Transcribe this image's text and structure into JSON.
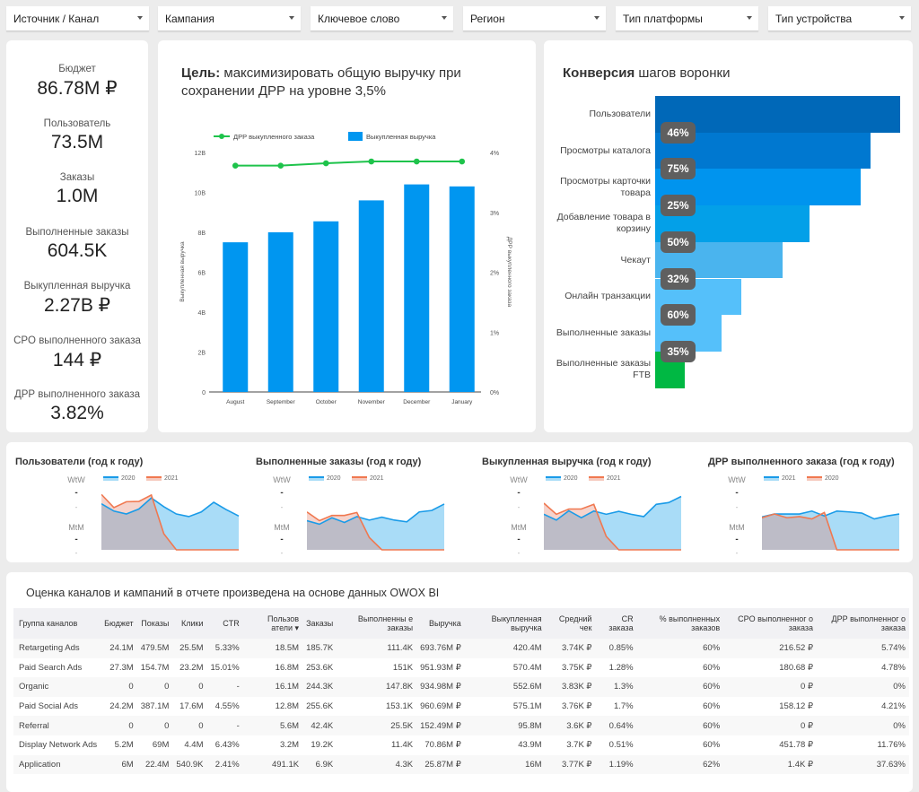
{
  "filters": [
    "Источник / Канал",
    "Кампания",
    "Ключевое слово",
    "Регион",
    "Тип платформы",
    "Тип устройства"
  ],
  "kpis": [
    {
      "label": "Бюджет",
      "value": "86.78M ₽"
    },
    {
      "label": "Пользователь",
      "value": "73.5M"
    },
    {
      "label": "Заказы",
      "value": "1.0M"
    },
    {
      "label": "Выполненные заказы",
      "value": "604.5K"
    },
    {
      "label": "Выкупленная выручка",
      "value": "2.27B ₽"
    },
    {
      "label": "CPO выполненного заказа",
      "value": "144 ₽"
    },
    {
      "label": "ДРР выполненного заказа",
      "value": "3.82%"
    }
  ],
  "goal_title": {
    "bold": "Цель:",
    "rest": " максимизировать общую выручку при сохранении ДРР на уровне 3,5%"
  },
  "chart_data": [
    {
      "type": "bar+line",
      "categories": [
        "August",
        "September",
        "October",
        "November",
        "December",
        "January"
      ],
      "series": [
        {
          "name": "Выкупленная выручка",
          "kind": "bar",
          "axis": "left",
          "color": "#0096f0",
          "values": [
            7.5,
            8.0,
            8.55,
            9.6,
            10.4,
            10.3
          ]
        },
        {
          "name": "ДРР выкупленного заказа",
          "kind": "line",
          "axis": "right",
          "color": "#1ec34b",
          "values": [
            3.78,
            3.78,
            3.82,
            3.85,
            3.85,
            3.85
          ]
        }
      ],
      "ylabel": "Выкупленная выручка",
      "y2label": "ДРР выкупленного заказа",
      "ylim": [
        0,
        12
      ],
      "y_ticks": [
        "0",
        "2B",
        "4B",
        "6B",
        "8B",
        "10B",
        "12B"
      ],
      "y2lim": [
        0,
        4
      ],
      "y2_ticks": [
        "0%",
        "1%",
        "2%",
        "3%",
        "4%"
      ],
      "legend": "top",
      "grid": false
    },
    {
      "type": "funnel",
      "title_bold": "Конверсия",
      "title_rest": " шагов воронки",
      "steps": [
        {
          "label": "Пользователи",
          "relative": 1.0,
          "color": "#0068b8"
        },
        {
          "label": "Просмотры каталога",
          "relative": 0.88,
          "color": "#0078d0"
        },
        {
          "label": "Просмотры карточки товара",
          "relative": 0.84,
          "color": "#0094ee"
        },
        {
          "label": "Добавление товара в корзину",
          "relative": 0.63,
          "color": "#03a0e8"
        },
        {
          "label": "Чекаут",
          "relative": 0.52,
          "color": "#4ab4ee"
        },
        {
          "label": "Онлайн транзакции",
          "relative": 0.35,
          "color": "#55c0fa"
        },
        {
          "label": "Выполненные заказы",
          "relative": 0.27,
          "color": "#55c0fa"
        },
        {
          "label": "Выполненные заказы FTB",
          "relative": 0.12,
          "color": "#00b843"
        }
      ],
      "conversions": [
        "46%",
        "75%",
        "25%",
        "50%",
        "32%",
        "60%",
        "35%"
      ]
    },
    {
      "type": "area",
      "title": "Пользователи (год к году)",
      "labels": [
        "WtW",
        "MtM"
      ],
      "series": [
        {
          "name": "2020",
          "color": "#1a9be8",
          "values": [
            158,
            133,
            123,
            140,
            178,
            148,
            123,
            114,
            130,
            163,
            138,
            116
          ]
        },
        {
          "name": "2021",
          "color": "#f07850",
          "values": [
            190,
            145,
            165,
            166,
            188,
            55,
            0,
            0,
            0,
            0,
            0,
            0
          ]
        }
      ]
    },
    {
      "type": "area",
      "title": "Выполненные заказы (год к году)",
      "labels": [
        "WtW",
        "MtM"
      ],
      "series": [
        {
          "name": "2020",
          "color": "#1a9be8",
          "values": [
            100,
            88,
            110,
            94,
            114,
            102,
            112,
            102,
            96,
            130,
            135,
            157
          ]
        },
        {
          "name": "2021",
          "color": "#f07850",
          "values": [
            130,
            100,
            118,
            118,
            128,
            42,
            0,
            0,
            0,
            0,
            0,
            0
          ]
        }
      ]
    },
    {
      "type": "area",
      "title": "Выкупленная выручка (год к году)",
      "labels": [
        "WtW",
        "MtM"
      ],
      "series": [
        {
          "name": "2020",
          "color": "#1a9be8",
          "values": [
            122,
            102,
            134,
            110,
            133,
            122,
            132,
            122,
            114,
            156,
            162,
            183
          ]
        },
        {
          "name": "2021",
          "color": "#f07850",
          "values": [
            160,
            122,
            140,
            140,
            156,
            46,
            0,
            0,
            0,
            0,
            0,
            0
          ]
        }
      ]
    },
    {
      "type": "area",
      "title": "ДРР выполненного заказа (год к году)",
      "labels": [
        "WtW",
        "MtM"
      ],
      "series": [
        {
          "name": "2021",
          "color": "#1a9be8",
          "values": [
            113,
            123,
            123,
            123,
            133,
            116,
            133,
            130,
            126,
            106,
            116,
            123
          ]
        },
        {
          "name": "2020",
          "color": "#f07850",
          "values": [
            110,
            123,
            110,
            114,
            106,
            128,
            0,
            0,
            0,
            0,
            0,
            0
          ]
        }
      ]
    }
  ],
  "table": {
    "title": "Оценка каналов и кампаний в отчете произведена на основе данных OWOX BI",
    "columns": [
      "Группа каналов",
      "Бюджет",
      "Показы",
      "Клики",
      "CTR",
      "Пользов атели ▾",
      "Заказы",
      "Выполненны е заказы",
      "Выручка",
      "Выкупленная выручка",
      "Средний чек",
      "CR заказа",
      "% выполненных заказов",
      "CPO выполненног о заказа",
      "ДРР выполненног о заказа"
    ],
    "rows": [
      [
        "Retargeting Ads",
        "24.1M",
        "479.5M",
        "25.5M",
        "5.33%",
        "18.5M",
        "185.7K",
        "111.4K",
        "693.76M ₽",
        "420.4M",
        "3.74K ₽",
        "0.85%",
        "60%",
        "216.52 ₽",
        "5.74%"
      ],
      [
        "Paid Search Ads",
        "27.3M",
        "154.7M",
        "23.2M",
        "15.01%",
        "16.8M",
        "253.6K",
        "151K",
        "951.93M ₽",
        "570.4M",
        "3.75K ₽",
        "1.28%",
        "60%",
        "180.68 ₽",
        "4.78%"
      ],
      [
        "Organic",
        "0",
        "0",
        "0",
        "-",
        "16.1M",
        "244.3K",
        "147.8K",
        "934.98M ₽",
        "552.6M",
        "3.83K ₽",
        "1.3%",
        "60%",
        "0 ₽",
        "0%"
      ],
      [
        "Paid Social Ads",
        "24.2M",
        "387.1M",
        "17.6M",
        "4.55%",
        "12.8M",
        "255.6K",
        "153.1K",
        "960.69M ₽",
        "575.1M",
        "3.76K ₽",
        "1.7%",
        "60%",
        "158.12 ₽",
        "4.21%"
      ],
      [
        "Referral",
        "0",
        "0",
        "0",
        "-",
        "5.6M",
        "42.4K",
        "25.5K",
        "152.49M ₽",
        "95.8M",
        "3.6K ₽",
        "0.64%",
        "60%",
        "0 ₽",
        "0%"
      ],
      [
        "Display Network Ads",
        "5.2M",
        "69M",
        "4.4M",
        "6.43%",
        "3.2M",
        "19.2K",
        "11.4K",
        "70.86M ₽",
        "43.9M",
        "3.7K ₽",
        "0.51%",
        "60%",
        "451.78 ₽",
        "11.76%"
      ],
      [
        "Application",
        "6M",
        "22.4M",
        "540.9K",
        "2.41%",
        "491.1K",
        "6.9K",
        "4.3K",
        "25.87M ₽",
        "16M",
        "3.77K ₽",
        "1.19%",
        "62%",
        "1.4K ₽",
        "37.63%"
      ]
    ]
  }
}
